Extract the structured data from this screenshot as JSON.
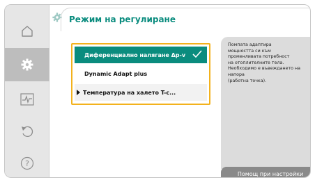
{
  "header": {
    "title": "Режим на регулиране",
    "title_color": "#0a8c7e",
    "icon": "gear-icon"
  },
  "sidebar": {
    "items": [
      {
        "icon": "home-icon",
        "active": false
      },
      {
        "icon": "gear-icon",
        "active": true
      },
      {
        "icon": "diagnostics-icon",
        "active": false
      },
      {
        "icon": "undo-icon",
        "active": false
      },
      {
        "icon": "help-icon",
        "active": false
      }
    ]
  },
  "options": {
    "items": [
      {
        "label": "Диференциално налягане Δp-v",
        "selected": true,
        "submenu": false
      },
      {
        "label": "Dynamic Adapt plus",
        "selected": false,
        "submenu": false
      },
      {
        "label": "Температура на халето T-с...",
        "selected": false,
        "submenu": true
      }
    ],
    "focus_color": "#f3b21d"
  },
  "help": {
    "text": "Помпата адаптира\nмощността си към\nпроменливата потребност\nна отоплителните тела.\nНеобходимо е въвеждането на\nнапора\n(работна точка).",
    "button_label": "Помощ при настройки"
  }
}
